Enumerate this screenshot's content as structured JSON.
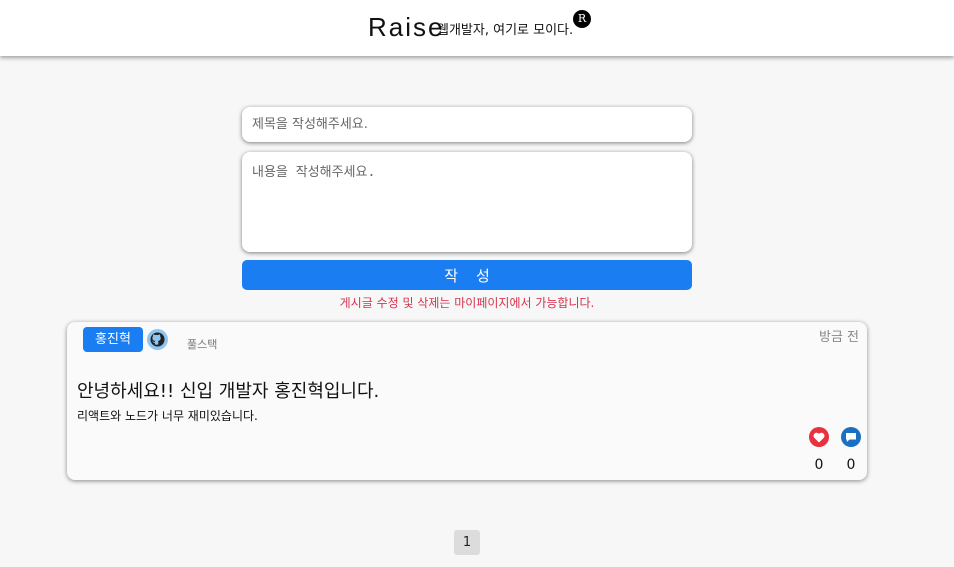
{
  "header": {
    "brand": "Raise",
    "tagline": "웹개발자, 여기로 모이다.",
    "registered_mark": "R"
  },
  "form": {
    "title_placeholder": "제목을 작성해주세요.",
    "content_placeholder": "내용을 작성해주세요.",
    "submit_label": "작성",
    "notice": "게시글 수정 및 삭제는 마이페이지에서 가능합니다."
  },
  "posts": [
    {
      "author": "홍진혁",
      "role": "풀스택",
      "time": "방금 전",
      "title": "안녕하세요!! 신입 개발자 홍진혁입니다.",
      "body": "리액트와 노드가 너무 재미있습니다.",
      "likes": "0",
      "comments": "0"
    }
  ],
  "pagination": {
    "current_page": "1"
  },
  "colors": {
    "accent": "#1a7ef2",
    "notice": "#d6334f",
    "like": "#e8303f",
    "comment": "#1b6fc0",
    "github_badge": "#8fc6ef"
  },
  "icons": [
    "github-icon",
    "heart-icon",
    "comment-icon"
  ]
}
